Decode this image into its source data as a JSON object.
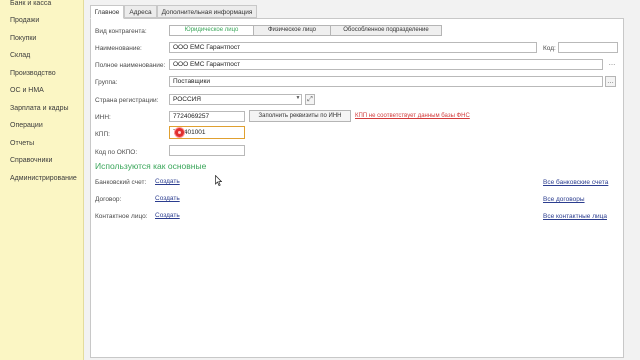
{
  "sidebar": {
    "items": [
      "Банк и касса",
      "Продажи",
      "Покупки",
      "Склад",
      "Производство",
      "ОС и НМА",
      "Зарплата и кадры",
      "Операции",
      "Отчеты",
      "Справочники",
      "Администрирование"
    ]
  },
  "tabs": [
    "Главное",
    "Адреса",
    "Дополнительная информация"
  ],
  "form": {
    "kind_label": "Вид контрагента:",
    "kind_options": [
      "Юридическое лицо",
      "Физическое лицо",
      "Обособленное подразделение"
    ],
    "name_label": "Наименование:",
    "name_value": "ООО ЕМС Гарантпост",
    "code_label": "Код:",
    "fullname_label": "Полное наименование:",
    "fullname_value": "ООО ЕМС Гарантпост",
    "group_label": "Группа:",
    "group_value": "Поставщики",
    "country_label": "Страна регистрации:",
    "country_value": "РОССИЯ",
    "inn_label": "ИНН:",
    "inn_value": "7724069257",
    "fill_button": "Заполнить реквизиты по ИНН",
    "kpp_warning": "КПП не соответствует данным базы ФНС",
    "kpp_label": "КПП:",
    "kpp_value": "772401001",
    "okpo_label": "Код по ОКПО:"
  },
  "defaults": {
    "title": "Используются как основные",
    "rows": [
      {
        "label": "Банковский счет:",
        "action": "Создать",
        "all": "Все банковские счета"
      },
      {
        "label": "Договор:",
        "action": "Создать",
        "all": "Все договоры"
      },
      {
        "label": "Контактное лицо:",
        "action": "Создать",
        "all": "Все контактные лица"
      }
    ]
  },
  "icons": {
    "dropdown": "dropdown-arrow-icon",
    "link": "link-icon",
    "more": "ellipsis-icon",
    "cursor": "mouse-pointer-icon"
  },
  "colors": {
    "sidebar_bg": "#fbf6c4",
    "accent_green": "#3aa65a",
    "link_blue": "#2b3d8f",
    "warning_red": "#d23b3b",
    "focus_orange": "#e0a030"
  }
}
